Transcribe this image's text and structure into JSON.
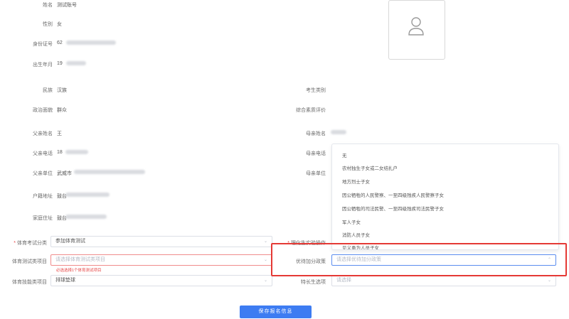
{
  "left_fields": [
    {
      "label": "姓名",
      "value": "测试账号"
    },
    {
      "label": "性别",
      "value": "女"
    },
    {
      "label": "身份证号",
      "value": "62"
    },
    {
      "label": "出生年月",
      "value": "19"
    },
    {
      "label": "民族",
      "value": "汉族"
    },
    {
      "label": "政治面貌",
      "value": "群众"
    },
    {
      "label": "父亲姓名",
      "value": "王"
    },
    {
      "label": "父亲电话",
      "value": "18"
    },
    {
      "label": "父亲单位",
      "value": "武威市"
    },
    {
      "label": "户籍地址",
      "value": "鼓台"
    },
    {
      "label": "家庭住址",
      "value": "鼓台"
    }
  ],
  "right_fields": [
    {
      "label": "考生类别",
      "value": ""
    },
    {
      "label": "综合素质评价",
      "value": ""
    },
    {
      "label": "母亲姓名",
      "value": ""
    },
    {
      "label": "母亲电话",
      "value": ""
    },
    {
      "label": "母亲单位",
      "value": ""
    }
  ],
  "form": {
    "pe_exam_category": {
      "label": "体育考试分类",
      "value": "参加体育测试"
    },
    "pe_exam_items": {
      "label": "体育测试类项目",
      "placeholder": "请选择体育测试类项目",
      "error": "必选选择1个体育测试项目"
    },
    "pe_skill_items": {
      "label": "体育技能类项目",
      "value": "排球垫球"
    },
    "lab_operation": {
      "label": "理化生实验操作"
    },
    "preferential_policy": {
      "label": "优待加分政策",
      "placeholder": "请选择优待加分政策"
    },
    "specialty": {
      "label": "特长生选项",
      "placeholder": "请选择"
    }
  },
  "dropdown_options": [
    "无",
    "农村独生子女或二女结扎户",
    "地方烈士子女",
    "因公牺牲的人民警察、一至四级残疾人民警察子女",
    "因公牺牲的司法民警、一至四级残疾司法民警子女",
    "军人子女",
    "消防人员子女",
    "见义勇为人员子女"
  ],
  "save_button": "保存报名信息",
  "colors": {
    "accent": "#3d7cf2",
    "error": "#e64545",
    "highlight": "#e53935"
  }
}
